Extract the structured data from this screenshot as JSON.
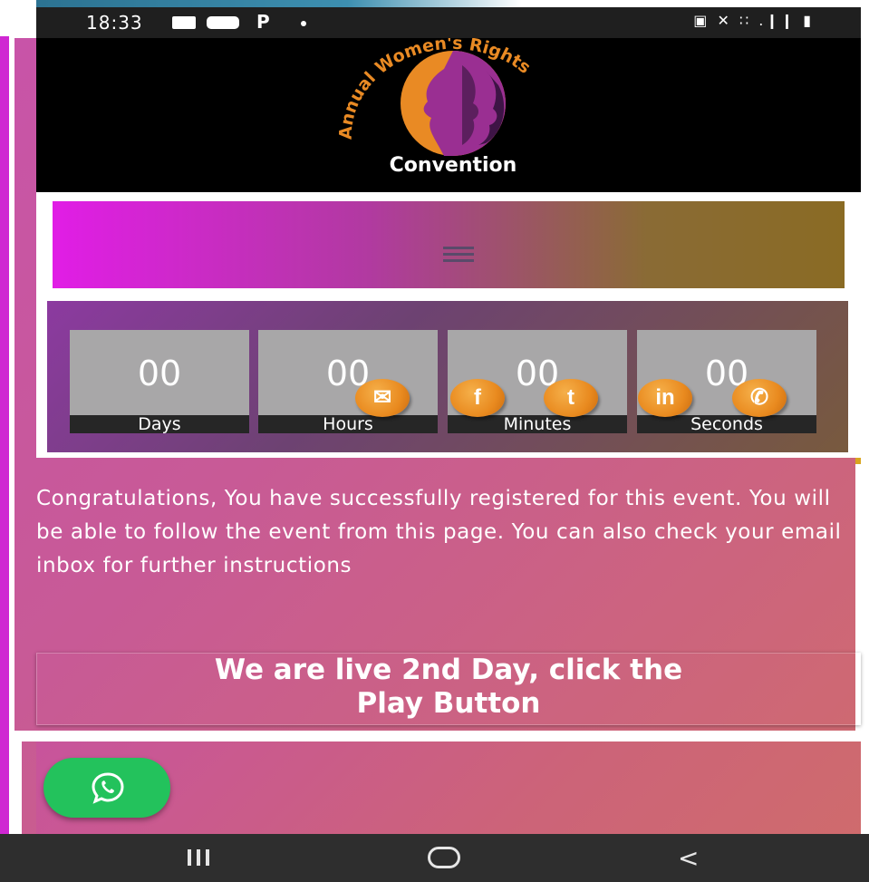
{
  "status_bar": {
    "time": "18:33",
    "left_icons": [
      "gallery-icon",
      "youtube-icon",
      "p-notification-icon",
      "dot-icon"
    ],
    "p_label": "P",
    "right_icons": [
      "alarm-icon",
      "mute-icon",
      "wifi-icon",
      "signal-icon",
      "battery-icon"
    ],
    "right_text": "▣ ✕ ∷ .❙❙ ▮"
  },
  "header": {
    "logo_arc_text": "Annual Women's Rights",
    "logo_title": "Convention"
  },
  "nav": {
    "menu_icon": "hamburger-icon"
  },
  "countdown": {
    "cells": [
      {
        "value": "00",
        "label": "Days"
      },
      {
        "value": "00",
        "label": "Hours"
      },
      {
        "value": "00",
        "label": "Minutes"
      },
      {
        "value": "00",
        "label": "Seconds"
      }
    ]
  },
  "share_buttons": [
    {
      "icon": "email-icon",
      "glyph": "✉"
    },
    {
      "icon": "facebook-icon",
      "glyph": "f"
    },
    {
      "icon": "twitter-icon",
      "glyph": "t"
    },
    {
      "icon": "linkedin-icon",
      "glyph": "in"
    },
    {
      "icon": "whatsapp-icon",
      "glyph": "✆"
    }
  ],
  "message": "Congratulations, You have successfully registered for this event. You will be able to follow the event from this page. You can also check your email inbox for further instructions",
  "live_banner": {
    "line1": "We are live 2nd Day, click the",
    "line2": "Play Button"
  },
  "floating_whatsapp": {
    "icon": "whatsapp-icon"
  },
  "android_nav": {
    "recents": "recents-icon",
    "home": "home-icon",
    "back": "back-icon",
    "back_glyph": "<"
  },
  "colors": {
    "nav_gradient_start": "#e11de6",
    "nav_gradient_end": "#8a6b24",
    "page_bg": "#c854a8",
    "share_orange": "#e98a1f",
    "whatsapp_green": "#23c25c"
  }
}
